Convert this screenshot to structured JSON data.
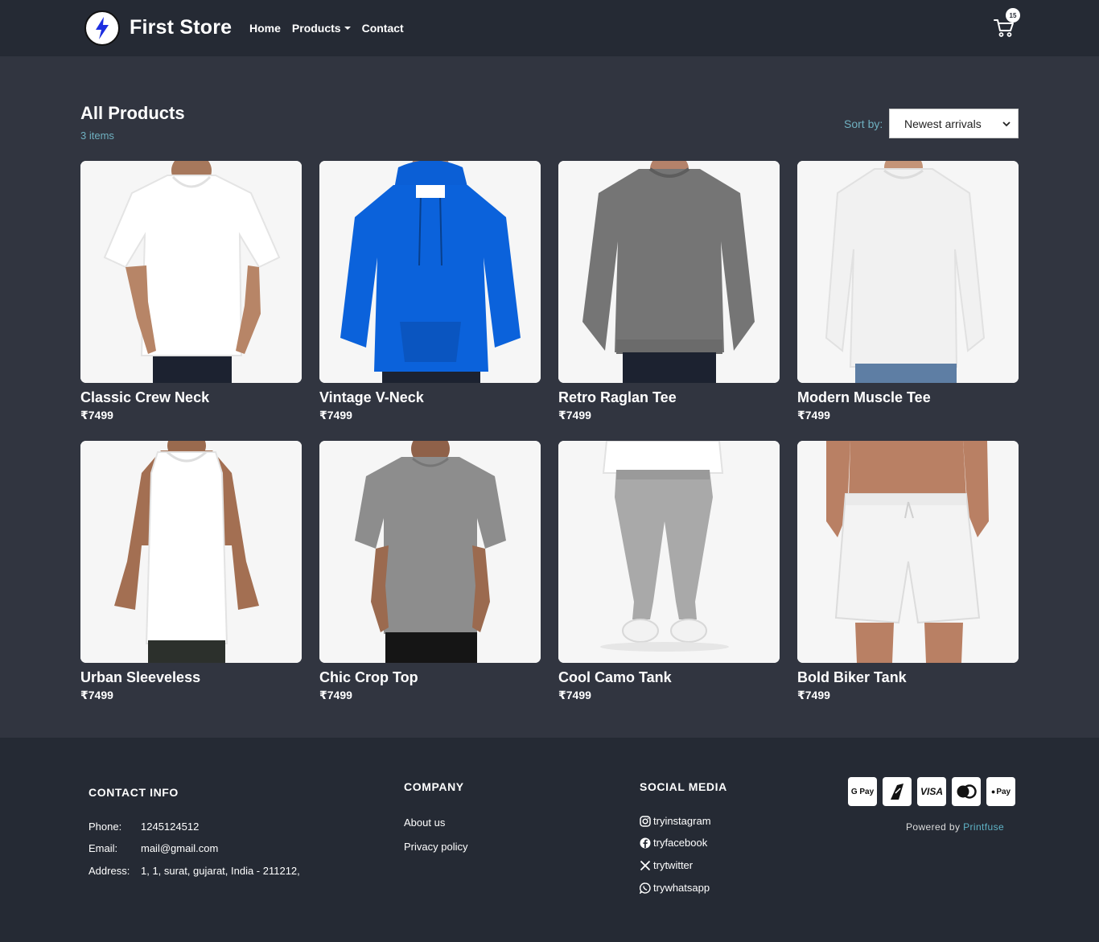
{
  "nav": {
    "brand": "First Store",
    "links": [
      "Home",
      "Products",
      "Contact"
    ],
    "cart_count": "15"
  },
  "header": {
    "title": "All Products",
    "count": "3 items",
    "sort_label": "Sort by:",
    "sort_value": "Newest arrivals"
  },
  "products": [
    {
      "name": "Classic Crew Neck",
      "price": "₹7499"
    },
    {
      "name": "Vintage V-Neck",
      "price": "₹7499"
    },
    {
      "name": "Retro Raglan Tee",
      "price": "₹7499"
    },
    {
      "name": "Modern Muscle Tee",
      "price": "₹7499"
    },
    {
      "name": "Urban Sleeveless",
      "price": "₹7499"
    },
    {
      "name": "Chic Crop Top",
      "price": "₹7499"
    },
    {
      "name": "Cool Camo Tank",
      "price": "₹7499"
    },
    {
      "name": "Bold Biker Tank",
      "price": "₹7499"
    }
  ],
  "footer": {
    "contact": {
      "heading": "CONTACT INFO",
      "phone_label": "Phone:",
      "phone": "1245124512",
      "email_label": "Email:",
      "email": "mail@gmail.com",
      "address_label": "Address:",
      "address": "1, 1, surat, gujarat, India - 211212,"
    },
    "company": {
      "heading": "COMPANY",
      "links": [
        "About us",
        "Privacy policy"
      ]
    },
    "social": {
      "heading": "SOCIAL MEDIA",
      "links": [
        "tryinstagram",
        "tryfacebook",
        "trytwitter",
        "trywhatsapp"
      ]
    },
    "payments": [
      "G Pay",
      "VISA",
      "Pay"
    ],
    "powered_prefix": "Powered by",
    "powered_brand": "Printfuse"
  },
  "colors": {
    "page_bg": "#313540",
    "nav_bg": "#252a34",
    "accent": "#6fb0c0"
  }
}
